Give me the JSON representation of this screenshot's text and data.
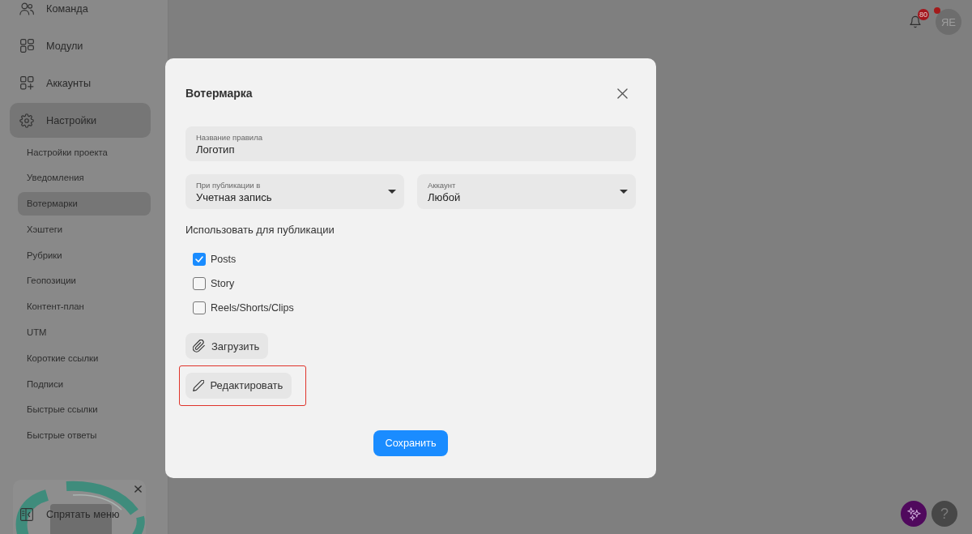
{
  "sidebar": {
    "items": [
      {
        "label": "Команда",
        "selected": false
      },
      {
        "label": "Модули",
        "selected": false
      },
      {
        "label": "Аккаунты",
        "selected": false
      },
      {
        "label": "Настройки",
        "selected": true,
        "children": [
          {
            "label": "Настройки проекта",
            "selected": false
          },
          {
            "label": "Уведомления",
            "selected": false
          },
          {
            "label": "Вотермарки",
            "selected": true
          },
          {
            "label": "Хэштеги",
            "selected": false
          },
          {
            "label": "Рубрики",
            "selected": false
          },
          {
            "label": "Геопозиции",
            "selected": false
          },
          {
            "label": "Контент-план",
            "selected": false
          },
          {
            "label": "UTM",
            "selected": false
          },
          {
            "label": "Короткие ссылки",
            "selected": false
          },
          {
            "label": "Подписи",
            "selected": false
          },
          {
            "label": "Быстрые ссылки",
            "selected": false
          },
          {
            "label": "Быстрые ответы",
            "selected": false
          }
        ]
      }
    ],
    "hide_menu": "Спрятать меню"
  },
  "header": {
    "notification_count": "80",
    "avatar": {
      "initials": "ЯЕ",
      "status_dot": true
    }
  },
  "dialog": {
    "title": "Вотермарка",
    "fields": [
      {
        "kind": "text",
        "label": "Название правила",
        "value": "Логотип"
      },
      {
        "kind": "select",
        "label": "При публикации в",
        "value": "Учетная запись"
      },
      {
        "kind": "select",
        "label": "Аккаунт",
        "value": "Любой"
      }
    ],
    "section_label": "Использовать для публикации",
    "options": [
      {
        "label": "Posts",
        "checked": true
      },
      {
        "label": "Story",
        "checked": false
      },
      {
        "label": "Reels/Shorts/Clips",
        "checked": false
      }
    ],
    "buttons": [
      {
        "kind": "upload",
        "label": "Загрузить",
        "highlighted": false
      },
      {
        "kind": "edit",
        "label": "Редактировать",
        "highlighted": true
      }
    ],
    "save_button": "Сохранить"
  },
  "floating_buttons": [
    {
      "kind": "assistant"
    },
    {
      "kind": "help",
      "label": "?"
    }
  ]
}
